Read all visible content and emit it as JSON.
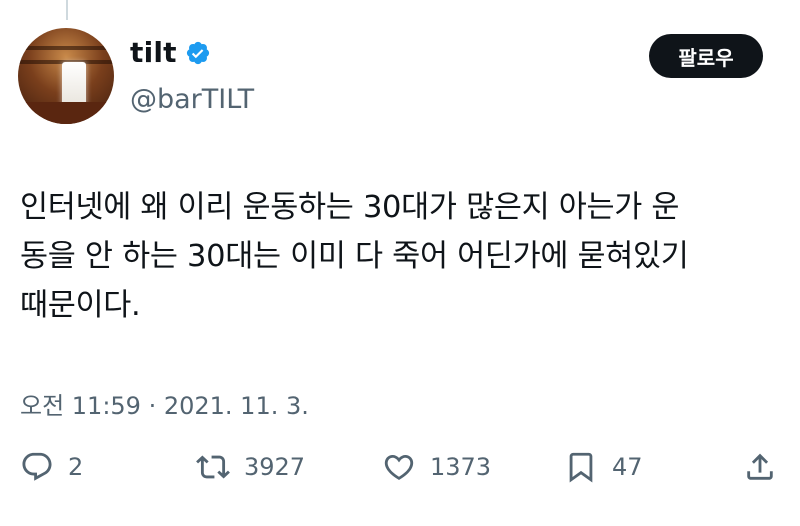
{
  "tweet": {
    "display_name": "tilt",
    "handle": "@barTILT",
    "follow_label": "팔로우",
    "text_lines": [
      "인터넷에 왜 이리 운동하는 30대가 많은지 아는가 운",
      "동을 안 하는 30대는 이미 다 죽어 어딘가에 묻혀있기",
      "때문이다."
    ],
    "timestamp": "오전 11:59 · 2021. 11. 3."
  },
  "actions": {
    "replies": "2",
    "retweets": "3927",
    "likes": "1373",
    "bookmarks": "47"
  },
  "icons": {
    "verified": "verified-badge-icon",
    "reply": "reply-icon",
    "retweet": "retweet-icon",
    "like": "heart-icon",
    "bookmark": "bookmark-icon",
    "share": "share-icon"
  },
  "colors": {
    "verified": "#1d9bf0",
    "text": "#0f1419",
    "secondary": "#536471",
    "follow_bg": "#0f1419"
  }
}
